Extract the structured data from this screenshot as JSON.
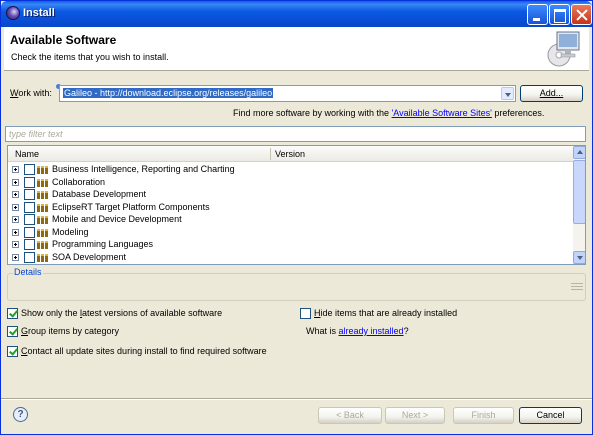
{
  "window": {
    "title": "Install",
    "controls": [
      "minimize-icon",
      "maximize-icon",
      "close-icon"
    ]
  },
  "banner": {
    "title": "Available Software",
    "description": "Check the items that you wish to install.",
    "image": "computer-monitor-icon"
  },
  "work_with": {
    "label_prefix": "W",
    "label_rest": "ork with:",
    "value": "Galileo - http://download.eclipse.org/releases/galileo",
    "add_button": "Add...",
    "hint_prefix": "Find more software by working with the ",
    "hint_link": "'Available Software Sites'",
    "hint_suffix": " preferences."
  },
  "filter": {
    "placeholder": "type filter text"
  },
  "tree": {
    "columns": [
      "Name",
      "Version"
    ],
    "items": [
      {
        "label": "Business Intelligence, Reporting and Charting",
        "checked": false
      },
      {
        "label": "Collaboration",
        "checked": false
      },
      {
        "label": "Database Development",
        "checked": false
      },
      {
        "label": "EclipseRT Target Platform Components",
        "checked": false
      },
      {
        "label": "Mobile and Device Development",
        "checked": false
      },
      {
        "label": "Modeling",
        "checked": false
      },
      {
        "label": "Programming Languages",
        "checked": false
      },
      {
        "label": "SOA Development",
        "checked": false
      }
    ]
  },
  "details": {
    "title": "Details"
  },
  "options": {
    "latest_pre": "Show only the ",
    "latest_u": "l",
    "latest_post": "atest versions of available software",
    "latest_checked": true,
    "hide_pre": "",
    "hide_u": "H",
    "hide_post": "ide items that are already installed",
    "hide_checked": false,
    "group_pre": "",
    "group_u": "G",
    "group_post": "roup items by category",
    "group_checked": true,
    "what_is": "What is ",
    "already_installed_link": "already installed",
    "what_is_suffix": "?",
    "contact_pre": "",
    "contact_u": "C",
    "contact_post": "ontact all update sites during install to find required software",
    "contact_checked": true
  },
  "footer": {
    "back": "< Back",
    "next": "Next >",
    "finish": "Finish",
    "cancel": "Cancel",
    "help_icon": "help-icon"
  }
}
